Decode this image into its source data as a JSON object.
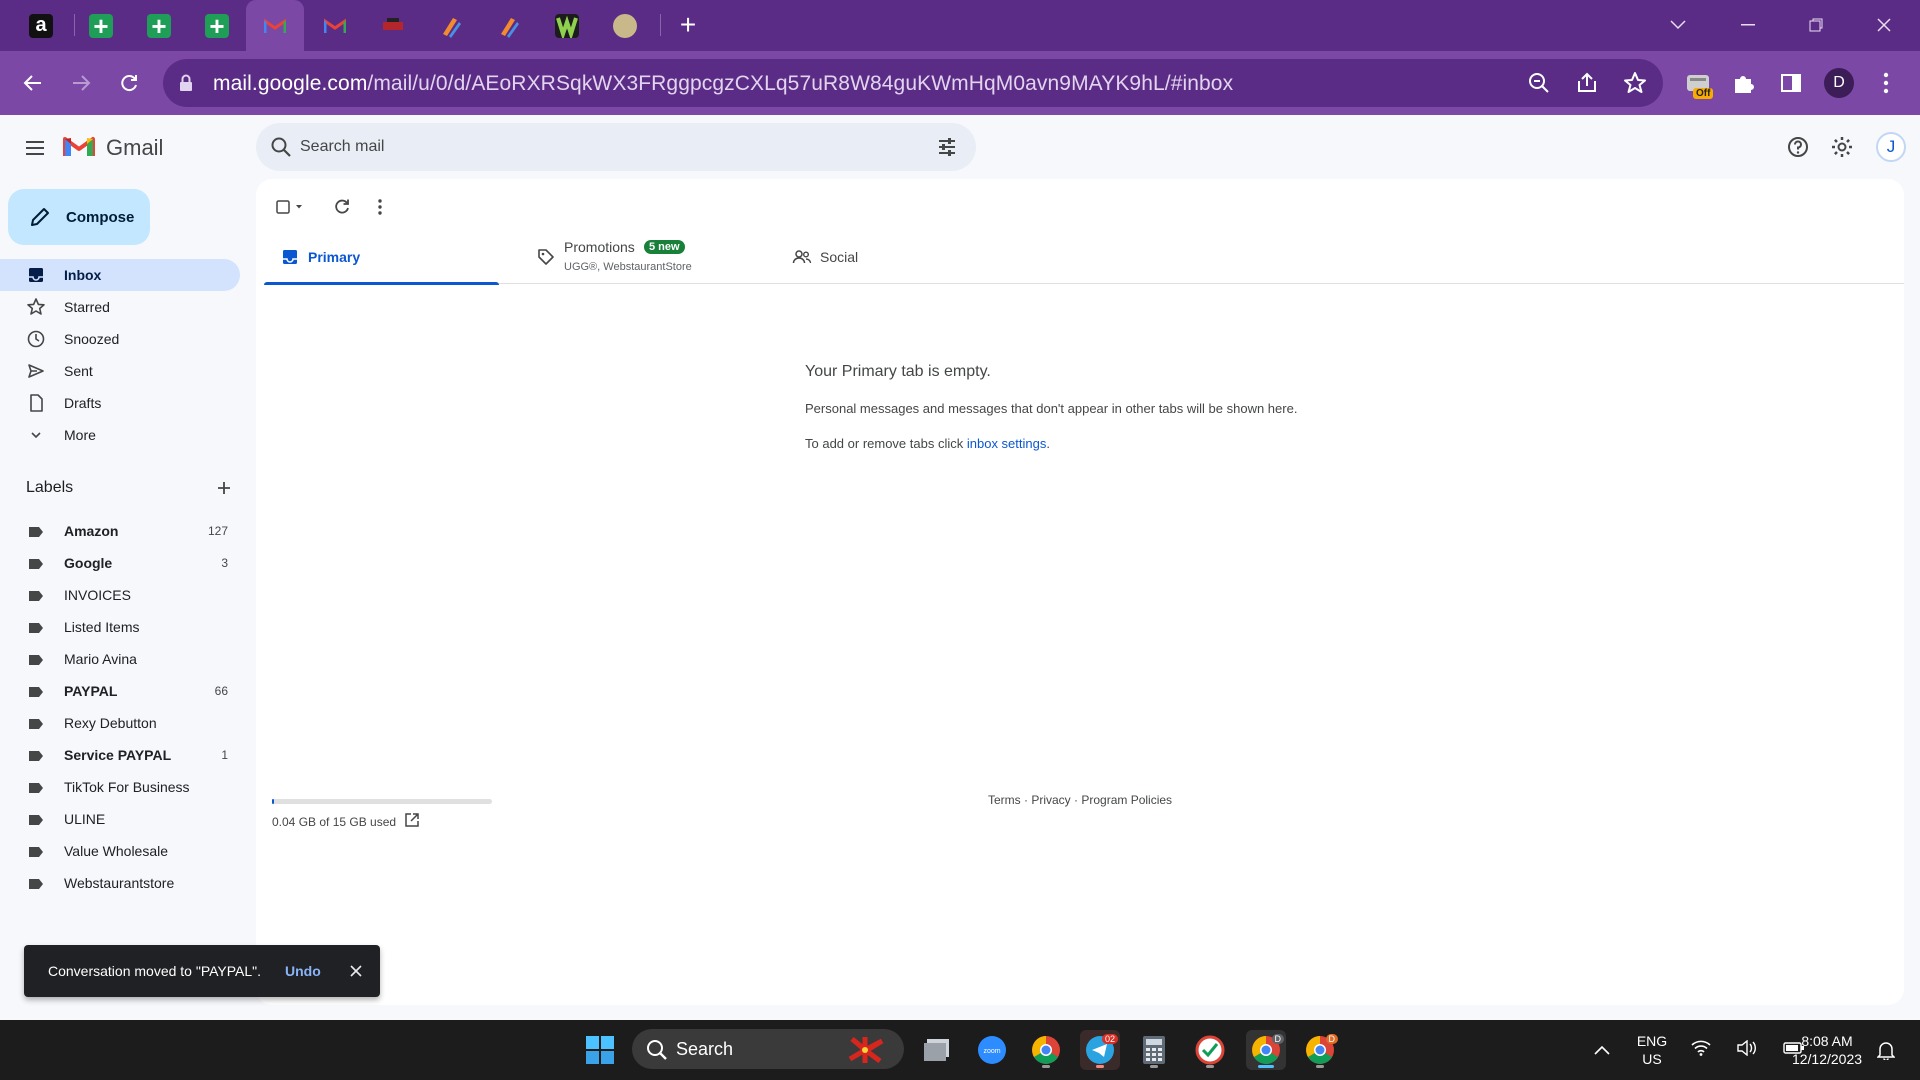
{
  "browser": {
    "url_host": "mail.google.com",
    "url_path": "/mail/u/0/d/AEoRXRSqkWX3FRggpcgzCXLq57uR8W84guKWmHqM0avn9MAYK9hL/#inbox",
    "extension_badge": "Off",
    "profile_initial": "D",
    "tabs": [
      "amazon-icon",
      "sheets-icon",
      "sheets-icon",
      "gmail-icon",
      "gmail-icon",
      "app-icon",
      "pencil-app-icon",
      "pencil-app-icon",
      "w-app-icon",
      "uline-icon"
    ]
  },
  "gmail": {
    "app_name": "Gmail",
    "search_placeholder": "Search mail",
    "account_initial": "J",
    "compose_label": "Compose",
    "nav": [
      {
        "label": "Inbox",
        "icon": "inbox-icon"
      },
      {
        "label": "Starred",
        "icon": "star-icon"
      },
      {
        "label": "Snoozed",
        "icon": "clock-icon"
      },
      {
        "label": "Sent",
        "icon": "send-icon"
      },
      {
        "label": "Drafts",
        "icon": "draft-icon"
      },
      {
        "label": "More",
        "icon": "chevron-down-icon"
      }
    ],
    "labels_heading": "Labels",
    "labels": [
      {
        "name": "Amazon",
        "count": "127",
        "bold": true
      },
      {
        "name": "Google",
        "count": "3",
        "bold": true
      },
      {
        "name": "INVOICES",
        "count": "",
        "bold": false
      },
      {
        "name": "Listed Items",
        "count": "",
        "bold": false
      },
      {
        "name": "Mario Avina",
        "count": "",
        "bold": false
      },
      {
        "name": "PAYPAL",
        "count": "66",
        "bold": true
      },
      {
        "name": "Rexy Debutton",
        "count": "",
        "bold": false
      },
      {
        "name": "Service PAYPAL",
        "count": "1",
        "bold": true
      },
      {
        "name": "TikTok For Business",
        "count": "",
        "bold": false
      },
      {
        "name": "ULINE",
        "count": "",
        "bold": false
      },
      {
        "name": "Value Wholesale",
        "count": "",
        "bold": false
      },
      {
        "name": "Webstaurantstore",
        "count": "",
        "bold": false
      }
    ],
    "category_tabs": {
      "primary": "Primary",
      "promotions": "Promotions",
      "promotions_badge": "5 new",
      "promotions_sub": "UGG®, WebstaurantStore",
      "social": "Social"
    },
    "empty": {
      "title": "Your Primary tab is empty.",
      "line1": "Personal messages and messages that don't appear in other tabs will be shown here.",
      "line2_prefix": "To add or remove tabs click ",
      "line2_link": "inbox settings",
      "line2_suffix": "."
    },
    "storage": {
      "text": "0.04 GB of 15 GB used",
      "used_fraction": 0.003
    },
    "footer": {
      "terms": "Terms",
      "privacy": "Privacy",
      "policies": "Program Policies",
      "sep": " · "
    },
    "snackbar": {
      "message": "Conversation moved to \"PAYPAL\".",
      "action": "Undo"
    }
  },
  "taskbar": {
    "search_label": "Search",
    "lang": "ENG",
    "region": "US",
    "time": "8:08 AM",
    "date": "12/12/2023",
    "telegram_badge": "02",
    "chrome_badge_1": "D",
    "chrome_badge_2": "D",
    "zoom_label": "zoom"
  }
}
